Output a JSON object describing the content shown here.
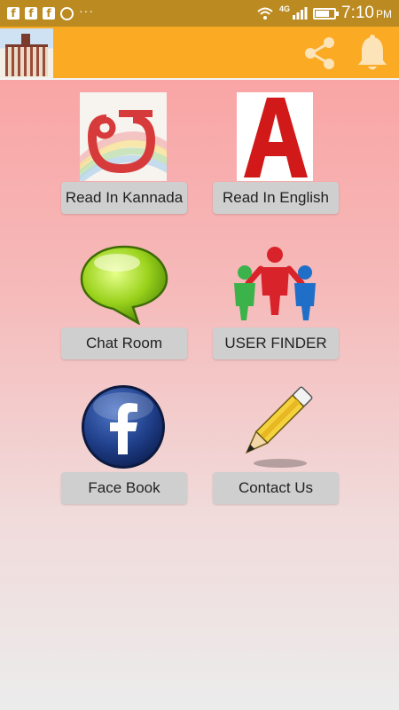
{
  "status_bar": {
    "network_label": "4G",
    "time": "7:10",
    "time_suffix": "PM",
    "battery_level_percent": 75
  },
  "app_bar": {
    "logo_icon": "building-logo-icon",
    "share_icon": "share-icon",
    "bell_icon": "bell-icon"
  },
  "menu": {
    "kannada": {
      "label": "Read In Kannada",
      "icon": "kannada-letter-icon"
    },
    "english": {
      "label": "Read In English",
      "icon": "letter-a-icon"
    },
    "chat": {
      "label": "Chat Room",
      "icon": "chat-bubble-icon"
    },
    "user_finder": {
      "label": "USER FINDER",
      "icon": "people-group-icon"
    },
    "facebook": {
      "label": "Face Book",
      "icon": "facebook-icon"
    },
    "contact": {
      "label": "Contact Us",
      "icon": "pencil-icon"
    }
  },
  "colors": {
    "status_bar": "#bb8a20",
    "app_bar": "#fbaa23",
    "button": "#cfcfcf",
    "background_top": "#fb9d9d",
    "background_bottom": "#ececec"
  }
}
